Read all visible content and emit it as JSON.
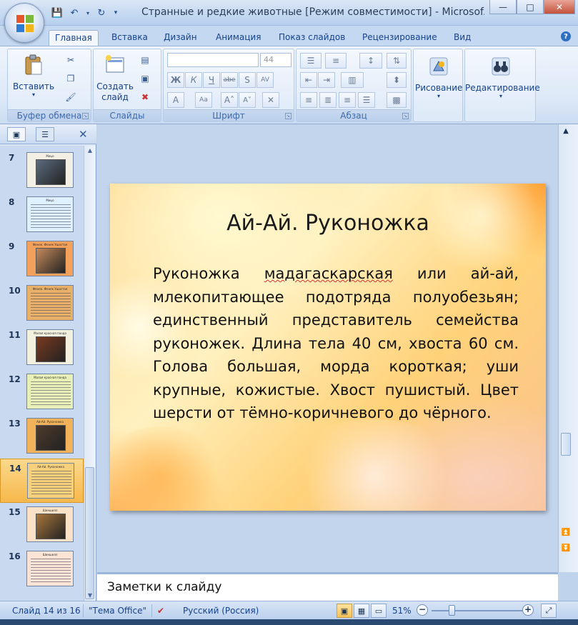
{
  "window": {
    "title": "Странные и редкие животные [Режим совместимости] - Microsof..."
  },
  "tabs": [
    "Главная",
    "Вставка",
    "Дизайн",
    "Анимация",
    "Показ слайдов",
    "Рецензирование",
    "Вид"
  ],
  "ribbon": {
    "clipboard": {
      "paste": "Вставить",
      "label": "Буфер обмена"
    },
    "slides": {
      "new_slide": "Создать слайд",
      "label": "Слайды"
    },
    "font": {
      "label": "Шрифт",
      "font_size": "44"
    },
    "paragraph": {
      "label": "Абзац"
    },
    "drawing": {
      "label": "Рисование"
    },
    "editing": {
      "label": "Редактирование"
    }
  },
  "slide_pane": {
    "thumbnails": [
      {
        "num": "7",
        "title": "Мицо",
        "kind": "photo",
        "bg": "#f4efe5",
        "photo": "#5b6b7e"
      },
      {
        "num": "8",
        "title": "Мицо",
        "kind": "text",
        "bg": "#dff0ff",
        "photo": ""
      },
      {
        "num": "9",
        "title": "Фенек. Фенек Ушастая",
        "kind": "photo",
        "bg": "#f3a05a",
        "photo": "#c4895a"
      },
      {
        "num": "10",
        "title": "Фенек. Фенек Ушастая",
        "kind": "text",
        "bg": "#e9b06a",
        "photo": ""
      },
      {
        "num": "11",
        "title": "Малая красная панда",
        "kind": "photo",
        "bg": "#f4f0e0",
        "photo": "#7a3a1f"
      },
      {
        "num": "12",
        "title": "Малая красная панда",
        "kind": "text",
        "bg": "#e8f0b8",
        "photo": ""
      },
      {
        "num": "13",
        "title": "Ай-Ай. Руконожка",
        "kind": "photo",
        "bg": "#f2b25a",
        "photo": "#4e3a2c"
      },
      {
        "num": "14",
        "title": "Ай-Ай. Руконожка",
        "kind": "text",
        "bg": "#f6d07a",
        "photo": ""
      },
      {
        "num": "15",
        "title": "Шиншилл",
        "kind": "photo",
        "bg": "#fbe2c7",
        "photo": "#a7753c"
      },
      {
        "num": "16",
        "title": "Шиншилл",
        "kind": "text",
        "bg": "#fbe3d6",
        "photo": ""
      }
    ],
    "selected": "14"
  },
  "slide": {
    "title": "Ай-Ай. Руконожка",
    "body_before": "Руконожка ",
    "body_underlined": "мадагаскарская",
    "body_after": " или ай-ай, млекопитающее подотряда полуобезьян; единственный представитель семейства руконожек. Длина тела 40 см, хвоста 60 см. Голова большая, морда короткая; уши крупные, кожистые. Хвост пушистый. Цвет шерсти от тёмно-коричневого до чёрного."
  },
  "notes": {
    "placeholder": "Заметки к слайду"
  },
  "status_bar": {
    "slide_info": "Слайд 14 из 16",
    "theme": "\"Тема Office\"",
    "language": "Русский (Россия)",
    "zoom": "51%"
  }
}
